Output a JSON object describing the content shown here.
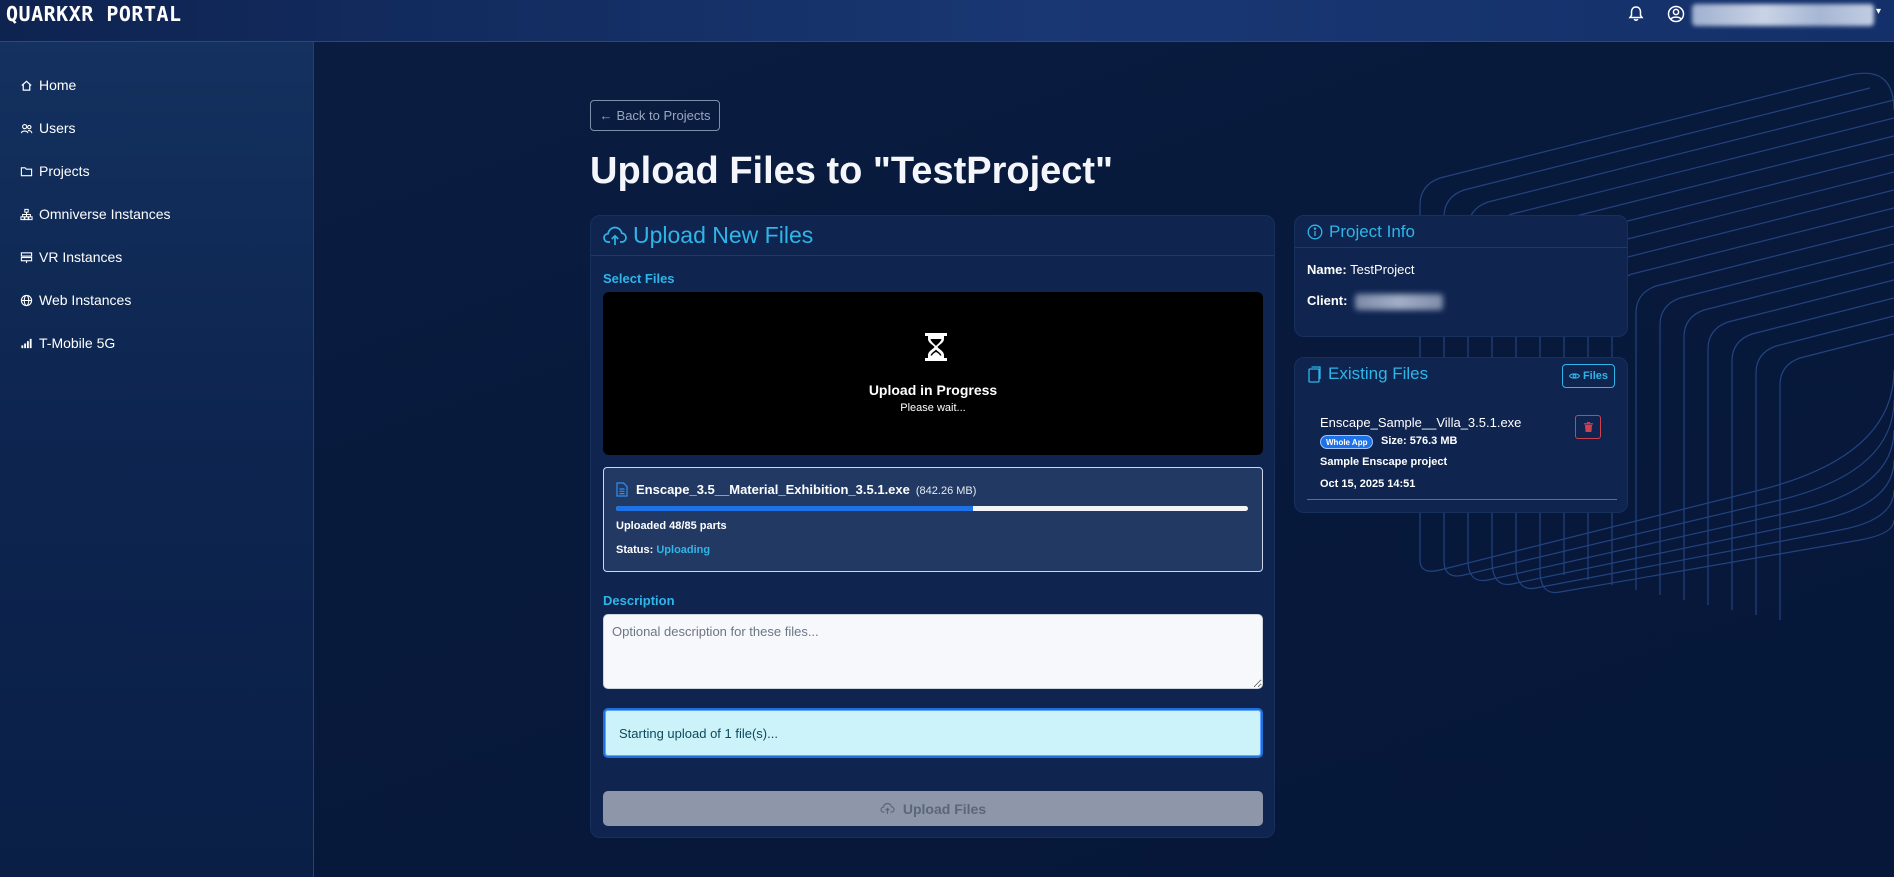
{
  "app": {
    "brand": "QUARKXR PORTAL"
  },
  "topbar": {
    "user_email": "••••••••••••••••••••"
  },
  "sidebar": {
    "items": [
      {
        "label": "Home",
        "icon": "home-icon"
      },
      {
        "label": "Users",
        "icon": "users-icon"
      },
      {
        "label": "Projects",
        "icon": "folder-icon"
      },
      {
        "label": "Omniverse Instances",
        "icon": "network-icon"
      },
      {
        "label": "VR Instances",
        "icon": "server-icon"
      },
      {
        "label": "Web Instances",
        "icon": "globe-icon"
      },
      {
        "label": "T-Mobile 5G",
        "icon": "signal-icon"
      }
    ]
  },
  "main": {
    "back_label": "Back to Projects",
    "title": "Upload Files to \"TestProject\"",
    "upload": {
      "header": "Upload New Files",
      "select_label": "Select Files",
      "dropzone_title": "Upload in Progress",
      "dropzone_sub": "Please wait...",
      "file_name": "Enscape_3.5__Material_Exhibition_3.5.1.exe",
      "file_size": "(842.26 MB)",
      "progress_fraction": 0.565,
      "parts_text": "Uploaded 48/85 parts",
      "status_label": "Status:",
      "status_value": "Uploading",
      "description_label": "Description",
      "description_placeholder": "Optional description for these files...",
      "description_value": "",
      "alert_text": "Starting upload of 1 file(s)...",
      "upload_button": "Upload Files"
    }
  },
  "project_info": {
    "header": "Project Info",
    "name_label": "Name:",
    "name_value": "TestProject",
    "client_label": "Client:"
  },
  "existing_files": {
    "header": "Existing Files",
    "files_button": "Files",
    "items": [
      {
        "name": "Enscape_Sample__Villa_3.5.1.exe",
        "badge": "Whole App",
        "size": "Size: 576.3 MB",
        "description": "Sample Enscape project",
        "date": "Oct 15, 2025 14:51"
      }
    ]
  },
  "colors": {
    "accent": "#2fb5e8",
    "progress": "#1e72e8",
    "danger": "#d04050",
    "background": "#081a3c"
  }
}
